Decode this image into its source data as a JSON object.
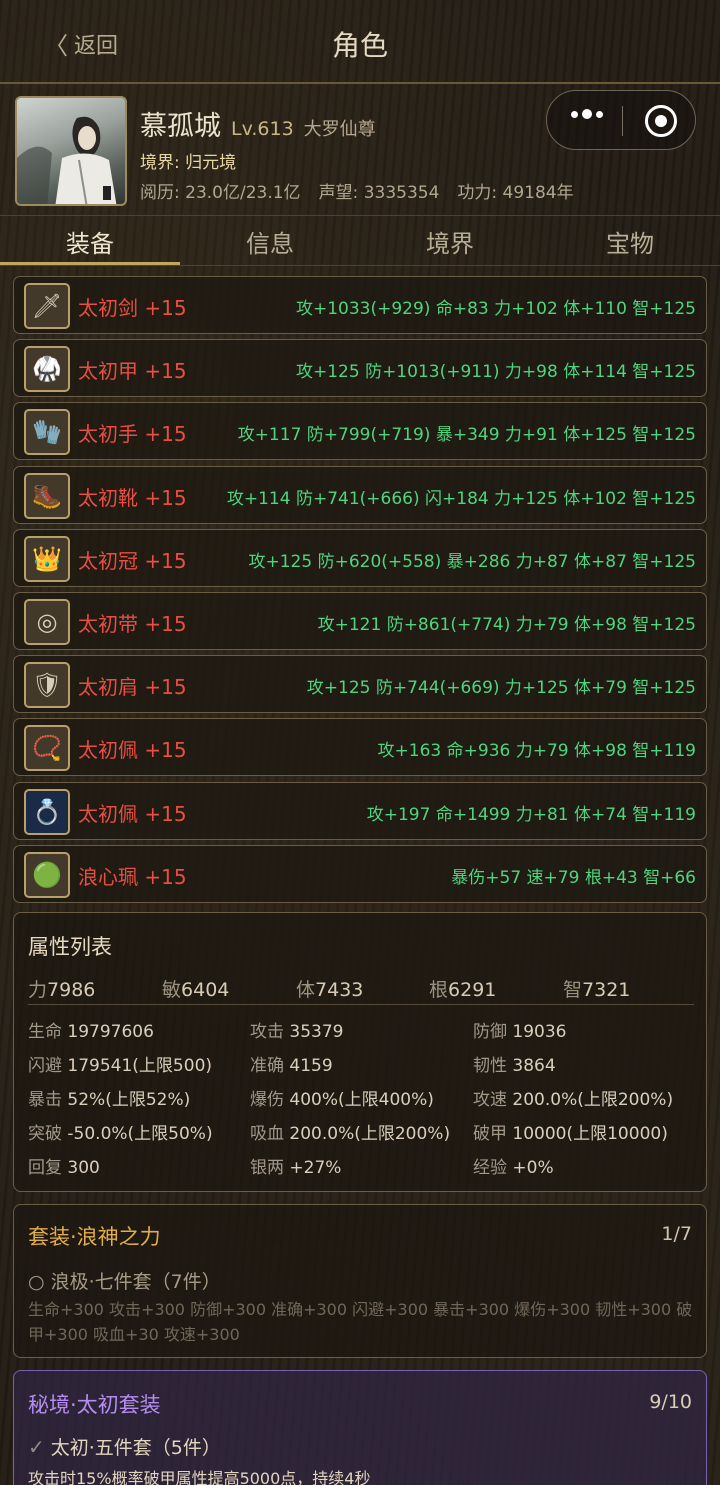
{
  "header": {
    "back_label": "返回",
    "title": "角色"
  },
  "profile": {
    "name": "慕孤城",
    "level": "Lv.613",
    "rank": "大罗仙尊",
    "realm": "境界: 归元境",
    "experience": "阅历: 23.0亿/23.1亿",
    "reputation": "声望: 3335354",
    "power": "功力: 49184年"
  },
  "tabs": [
    {
      "label": "装备",
      "active": true
    },
    {
      "label": "信息",
      "active": false
    },
    {
      "label": "境界",
      "active": false
    },
    {
      "label": "宝物",
      "active": false
    }
  ],
  "equipment": [
    {
      "name": "太初剑",
      "plus": "+15",
      "icon": "sword-icon",
      "stats": "攻+1033(+929) 命+83 力+102 体+110 智+125"
    },
    {
      "name": "太初甲",
      "plus": "+15",
      "icon": "armor-icon",
      "stats": "攻+125 防+1013(+911) 力+98 体+114 智+125"
    },
    {
      "name": "太初手",
      "plus": "+15",
      "icon": "gauntlet-icon",
      "stats": "攻+117 防+799(+719) 暴+349 力+91 体+125 智+125"
    },
    {
      "name": "太初靴",
      "plus": "+15",
      "icon": "boots-icon",
      "stats": "攻+114 防+741(+666) 闪+184 力+125 体+102 智+125"
    },
    {
      "name": "太初冠",
      "plus": "+15",
      "icon": "crown-icon",
      "stats": "攻+125 防+620(+558) 暴+286 力+87 体+87 智+125"
    },
    {
      "name": "太初带",
      "plus": "+15",
      "icon": "belt-icon",
      "stats": "攻+121 防+861(+774) 力+79 体+98 智+125"
    },
    {
      "name": "太初肩",
      "plus": "+15",
      "icon": "shoulder-icon",
      "stats": "攻+125 防+744(+669) 力+125 体+79 智+125"
    },
    {
      "name": "太初佩",
      "plus": "+15",
      "icon": "pendant-icon",
      "stats": "攻+163 命+936 力+79 体+98 智+119"
    },
    {
      "name": "太初佩",
      "plus": "+15",
      "icon": "ring-icon",
      "stats": "攻+197 命+1499 力+81 体+74 智+119"
    },
    {
      "name": "浪心珮",
      "plus": "+15",
      "icon": "jade-icon",
      "stats": "暴伤+57 速+79 根+43 智+66"
    }
  ],
  "attributes": {
    "title": "属性列表",
    "base": [
      {
        "k": "力",
        "v": "7986"
      },
      {
        "k": "敏",
        "v": "6404"
      },
      {
        "k": "体",
        "v": "7433"
      },
      {
        "k": "根",
        "v": "6291"
      },
      {
        "k": "智",
        "v": "7321"
      }
    ],
    "grid": [
      {
        "k": "生命",
        "v": "19797606"
      },
      {
        "k": "攻击",
        "v": "35379"
      },
      {
        "k": "防御",
        "v": "19036"
      },
      {
        "k": "闪避",
        "v": "179541(上限500)"
      },
      {
        "k": "准确",
        "v": "4159"
      },
      {
        "k": "韧性",
        "v": "3864"
      },
      {
        "k": "暴击",
        "v": "52%(上限52%)"
      },
      {
        "k": "爆伤",
        "v": "400%(上限400%)"
      },
      {
        "k": "攻速",
        "v": "200.0%(上限200%)"
      },
      {
        "k": "突破",
        "v": "-50.0%(上限50%)"
      },
      {
        "k": "吸血",
        "v": "200.0%(上限200%)"
      },
      {
        "k": "破甲",
        "v": "10000(上限10000)"
      },
      {
        "k": "回复",
        "v": "300"
      },
      {
        "k": "银两",
        "v": "+27%"
      },
      {
        "k": "经验",
        "v": "+0%"
      }
    ]
  },
  "set_bonus": {
    "title": "套装·浪神之力",
    "count": "1/7",
    "sub": "○ 浪极·七件套（7件）",
    "desc": "生命+300 攻击+300 防御+300 准确+300 闪避+300 暴击+300 爆伤+300 韧性+300 破甲+300 吸血+30 攻速+300"
  },
  "secret_set": {
    "title": "秘境·太初套装",
    "count": "9/10",
    "sub": "太初·五件套（5件）",
    "check": "✓",
    "desc": "攻击时15%概率破甲属性提高5000点，持续4秒"
  }
}
